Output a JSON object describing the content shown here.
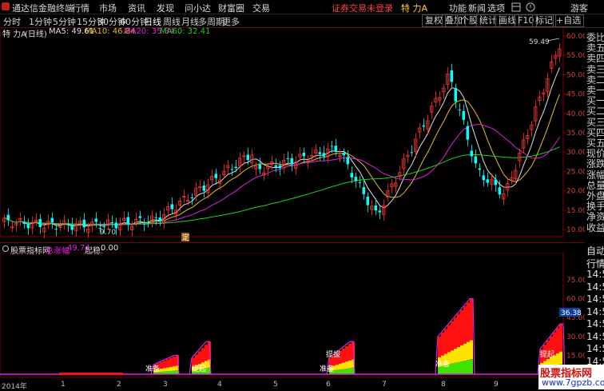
{
  "titlebar": {
    "app_title": "通达信金融终端",
    "menus": [
      "行情",
      "市场",
      "资讯",
      "发现",
      "问小达",
      "财富圈",
      "交易"
    ],
    "status_text": "证券交易未登录",
    "stock_name": "特 力A",
    "right_menus": [
      "功能",
      "新闻",
      "选项"
    ],
    "guest": "游客"
  },
  "toolbar": {
    "periods": [
      "分时",
      "1分钟",
      "5分钟",
      "15分钟",
      "30分钟",
      "60分钟",
      "日线",
      "周线",
      "月线",
      "多周期",
      "更多"
    ],
    "active_period": "日线",
    "right_buttons": [
      "复权",
      "叠加",
      "个股",
      "统计",
      "画线",
      "F10",
      "标记",
      "+自选"
    ]
  },
  "infoline": {
    "stock": "特 力A",
    "period": "(日线)",
    "ma": [
      {
        "label": "MA5: 49.61",
        "color": "#e0e0e0"
      },
      {
        "label": "MA10: 46.84",
        "color": "#e0c020"
      },
      {
        "label": "MA20: 35.84",
        "color": "#e020e0"
      },
      {
        "label": "MA60: 32.41",
        "color": "#20d020"
      }
    ]
  },
  "main_chart": {
    "price_axis": [
      "60.00",
      "55.00",
      "50.00",
      "45.00",
      "40.00",
      "35.00",
      "30.00",
      "25.00",
      "20.00",
      "15.00",
      "10.00"
    ],
    "annotation_high": "59.49",
    "annotation_low": "9.70",
    "marker_label": "定",
    "right_panel": [
      "委比",
      "卖五",
      "卖四",
      "卖三",
      "卖二",
      "卖一",
      "买一",
      "买二",
      "买三",
      "买四",
      "买五",
      "现价",
      "涨跌",
      "涨幅",
      "总量",
      "外盘",
      "换手",
      "净资",
      "收益"
    ]
  },
  "indicator": {
    "name": "股票指标网",
    "line1_label": "总涨幅",
    "line1_value": "49.74",
    "line2_label": "起稳:",
    "line2_value": "0.00",
    "axis": [
      "75.00",
      "60.00",
      "45.00",
      "30.00",
      "15.00"
    ],
    "current_value": "36.38",
    "labels": [
      "准备",
      "提起",
      "准备",
      "提拔",
      "准备",
      "提起"
    ],
    "right_panel": [
      "自动",
      "行情",
      "14:50",
      "14:50",
      "14:50",
      "14:50",
      "14:50",
      "14:50",
      "14:50",
      "14:50"
    ]
  },
  "time_axis": [
    "2014年",
    "1",
    "2",
    "3",
    "4",
    "5",
    "6",
    "7",
    "8",
    "9"
  ],
  "watermark": {
    "title": "股票指标网",
    "url": "www.7gpzb.com"
  },
  "colors": {
    "up": "#ff3030",
    "down": "#00ffff",
    "bg": "#000000",
    "grid": "#7a0000"
  }
}
